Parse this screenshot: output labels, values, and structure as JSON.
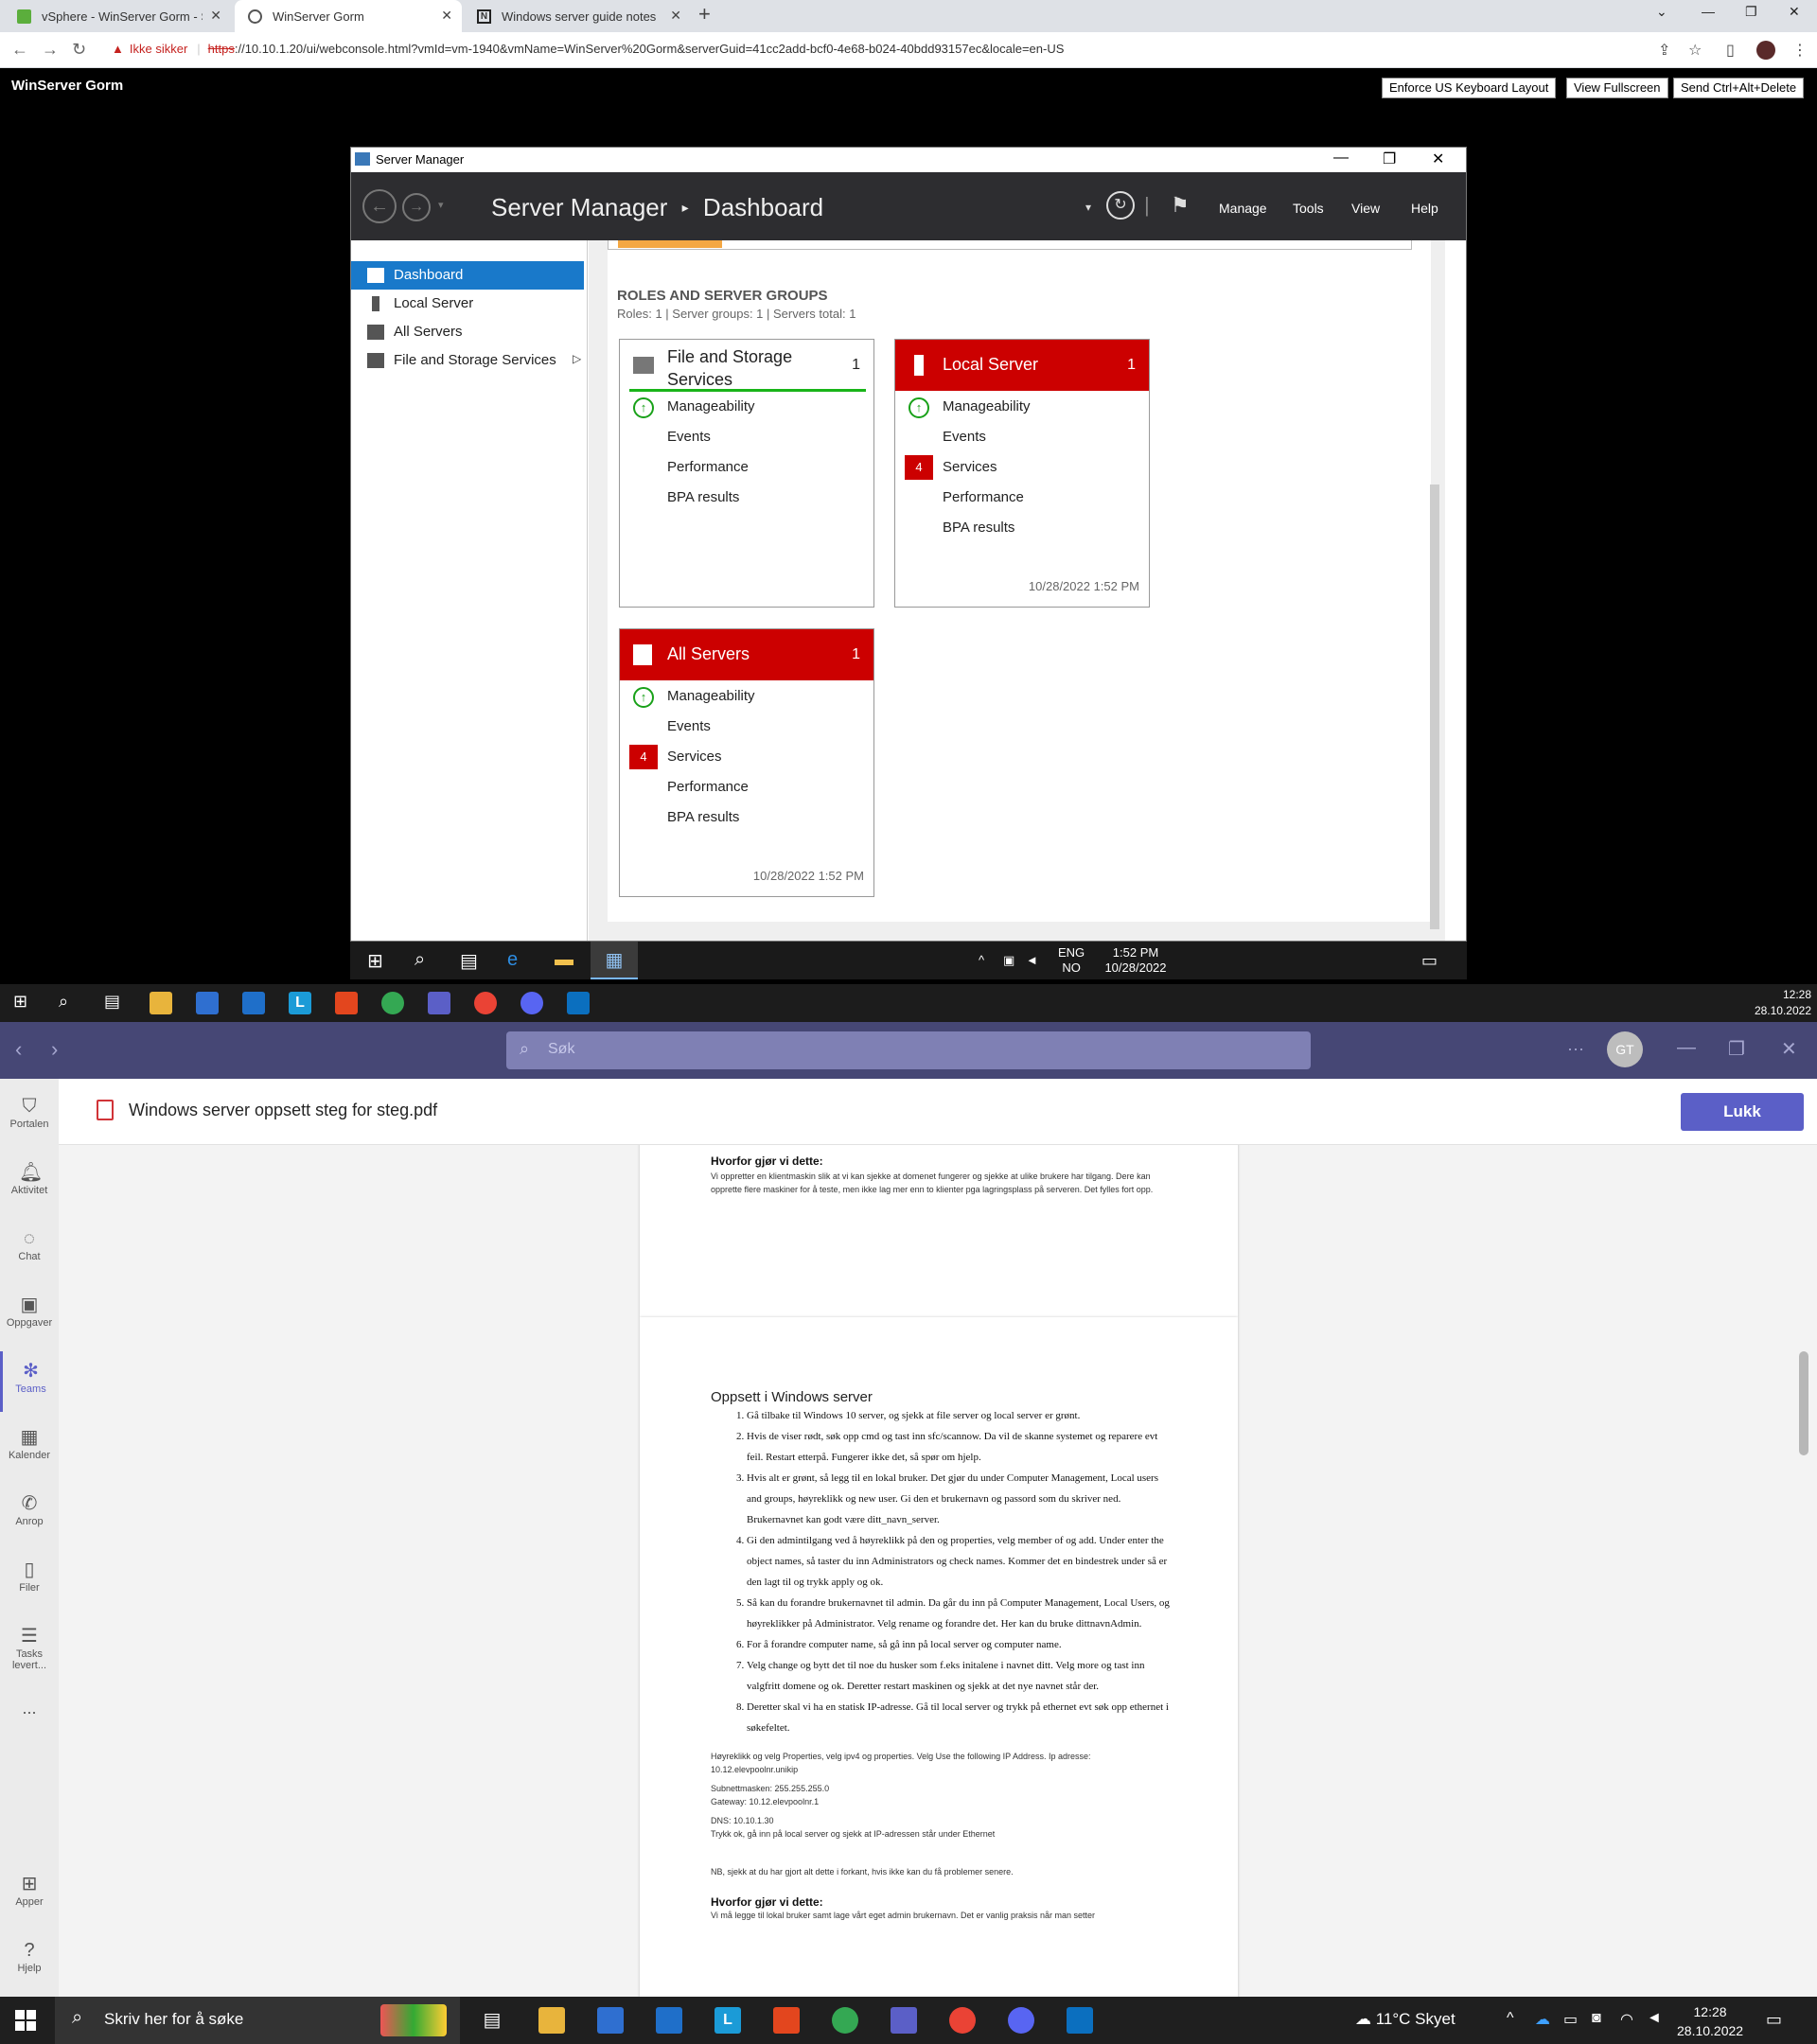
{
  "browser": {
    "tabs": [
      {
        "title": "vSphere - WinServer Gorm - Sum"
      },
      {
        "title": "WinServer Gorm"
      },
      {
        "title": "Windows server guide notes"
      }
    ],
    "security_label": "Ikke sikker",
    "url_scheme": "https",
    "url_rest": "://10.10.1.20/ui/webconsole.html?vmId=vm-1940&vmName=WinServer%20Gorm&serverGuid=41cc2add-bcf0-4e68-b024-40bdd93157ec&locale=en-US"
  },
  "vm": {
    "title": "WinServer Gorm",
    "buttons": {
      "keyboard": "Enforce US Keyboard Layout",
      "fullscreen": "View Fullscreen",
      "cad": "Send Ctrl+Alt+Delete"
    }
  },
  "server_manager": {
    "window_title": "Server Manager",
    "crumb_app": "Server Manager",
    "crumb_sep": "▸",
    "crumb_page": "Dashboard",
    "menu": {
      "manage": "Manage",
      "tools": "Tools",
      "view": "View",
      "help": "Help"
    },
    "nav": [
      {
        "label": "Dashboard",
        "selected": true
      },
      {
        "label": "Local Server",
        "selected": false
      },
      {
        "label": "All Servers",
        "selected": false
      },
      {
        "label": "File and Storage Services",
        "selected": false
      }
    ],
    "roles_title": "ROLES AND SERVER GROUPS",
    "roles_summary": "Roles: 1   |   Server groups: 1   |   Servers total: 1",
    "tiles": {
      "file_storage": {
        "title": "File and Storage Services",
        "count": "1",
        "rows": [
          "Manageability",
          "Events",
          "Performance",
          "BPA results"
        ]
      },
      "local_server": {
        "title": "Local Server",
        "count": "1",
        "rows": [
          "Manageability",
          "Events",
          "Services",
          "Performance",
          "BPA results"
        ],
        "services_badge": "4",
        "timestamp": "10/28/2022 1:52 PM"
      },
      "all_servers": {
        "title": "All Servers",
        "count": "1",
        "rows": [
          "Manageability",
          "Events",
          "Services",
          "Performance",
          "BPA results"
        ],
        "services_badge": "4",
        "timestamp": "10/28/2022 1:52 PM"
      }
    }
  },
  "vm_taskbar": {
    "lang1": "ENG",
    "lang2": "NO",
    "time": "1:52 PM",
    "date": "10/28/2022"
  },
  "host_taskbar_top": {
    "time": "12:28",
    "date": "28.10.2022"
  },
  "teams": {
    "search_placeholder": "Søk",
    "avatar_initials": "GT",
    "rail": [
      {
        "label": "Portalen",
        "icon": "shield-icon"
      },
      {
        "label": "Aktivitet",
        "icon": "bell-icon"
      },
      {
        "label": "Chat",
        "icon": "chat-icon"
      },
      {
        "label": "Oppgaver",
        "icon": "briefcase-icon"
      },
      {
        "label": "Teams",
        "icon": "teams-icon"
      },
      {
        "label": "Kalender",
        "icon": "calendar-icon"
      },
      {
        "label": "Anrop",
        "icon": "phone-icon"
      },
      {
        "label": "Filer",
        "icon": "file-icon"
      },
      {
        "label": "Tasks levert...",
        "icon": "tasks-icon"
      }
    ],
    "rail_more": "...",
    "rail_bottom": [
      {
        "label": "Apper",
        "icon": "apps-icon"
      },
      {
        "label": "Hjelp",
        "icon": "help-icon"
      }
    ],
    "file_name": "Windows server oppsett steg for steg.pdf",
    "close_label": "Lukk"
  },
  "pdf": {
    "page1": {
      "heading": "Hvorfor gjør vi dette:",
      "body": "Vi oppretter en klientmaskin slik at vi kan sjekke at domenet fungerer og sjekke at ulike brukere har tilgang. Dere kan opprette flere maskiner for å teste, men ikke lag mer enn to klienter pga lagringsplass på serveren. Det fylles fort opp."
    },
    "page2": {
      "title": "Oppsett i Windows server",
      "steps": [
        "Gå tilbake til Windows 10 server, og sjekk at file server og local server er grønt.",
        "Hvis de viser rødt, søk opp cmd og tast inn sfc/scannow. Da vil de skanne systemet og reparere evt feil. Restart etterpå. Fungerer ikke det, så spør om hjelp.",
        "Hvis alt er grønt, så legg til en lokal bruker. Det gjør du under Computer Management, Local users and groups, høyreklikk og new user. Gi den et brukernavn og passord som du skriver ned. Brukernavnet kan godt være ditt_navn_server.",
        "Gi den admintilgang ved å høyreklikk på den og properties, velg member of og add. Under enter the object names, så taster du inn Administrators og check names. Kommer det en bindestrek under så er den lagt til og trykk apply og ok.",
        "Så kan du forandre brukernavnet til admin. Da går du inn på Computer Management, Local Users, og høyreklikker på Administrator. Velg rename og forandre det. Her kan du bruke dittnavnAdmin.",
        "For å forandre computer name, så gå inn på local server og computer name.",
        "Velg change og bytt det til noe du husker som f.eks initalene i navnet ditt. Velg more og tast inn valgfritt domene  og ok. Deretter restart maskinen og sjekk at det nye navnet står der.",
        "Deretter skal vi ha en statisk IP-adresse. Gå til local server og trykk på ethernet evt søk opp ethernet i søkefeltet."
      ],
      "note1": "Høyreklikk og velg Properties, velg ipv4 og properties. Velg Use the following IP Address. Ip adresse: 10.12.elevpoolnr.unikip",
      "note2": "Subnettmasken: 255.255.255.0",
      "note3": "Gateway: 10.12.elevpoolnr.1",
      "note4": "DNS: 10.10.1.30",
      "note5": "Trykk ok, gå inn på local server og sjekk at IP-adressen står under Ethernet",
      "nb": "NB, sjekk at du har gjort alt dette i forkant, hvis ikke kan du få problemer senere.",
      "heading2": "Hvorfor gjør vi dette:",
      "body2": "Vi må legge til lokal bruker samt lage vårt eget admin brukernavn. Det er vanlig praksis når man setter"
    }
  },
  "win_taskbar": {
    "search_placeholder": "Skriv her for å søke",
    "weather": "11°C  Skyet",
    "time": "12:28",
    "date": "28.10.2022"
  }
}
